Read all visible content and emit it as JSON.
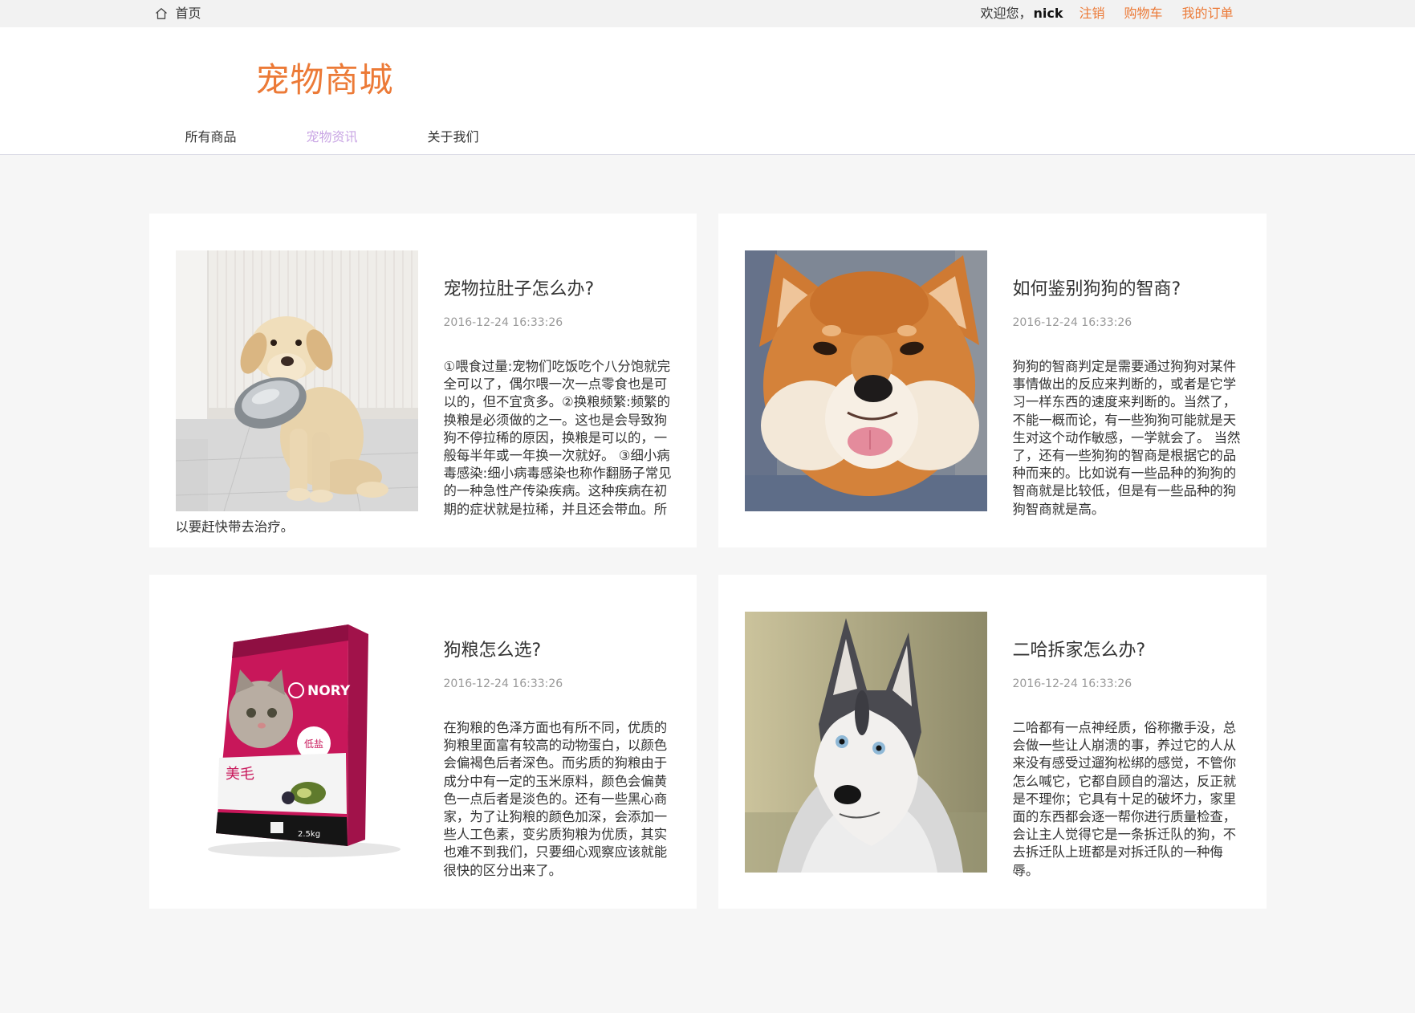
{
  "topbar": {
    "home_icon": "home-icon",
    "home_label": "首页",
    "welcome_text": "欢迎您，",
    "username": "nick",
    "links": [
      {
        "label": "注销"
      },
      {
        "label": "购物车"
      },
      {
        "label": "我的订单"
      }
    ]
  },
  "header": {
    "logo_text": "宠物商城",
    "nav": [
      {
        "label": "所有商品",
        "active": false
      },
      {
        "label": "宠物资讯",
        "active": true
      },
      {
        "label": "关于我们",
        "active": false
      }
    ]
  },
  "articles": [
    {
      "title": "宠物拉肚子怎么办?",
      "date": "2016-12-24 16:33:26",
      "content": "①喂食过量:宠物们吃饭吃个八分饱就完全可以了，偶尔喂一次一点零食也是可以的，但不宜贪多。②换粮频繁:频繁的换粮是必须做的之一。这也是会导致狗狗不停拉稀的原因，换粮是可以的，一般每半年或一年换一次就好。 ③细小病毒感染:细小病毒感染也称作翻肠子常见的一种急性产传染疾病。这种疾病在初期的症状就是拉稀，并且还会带血。所以要赶快带去治疗。"
    },
    {
      "title": "如何鉴别狗狗的智商?",
      "date": "2016-12-24 16:33:26",
      "content": "狗狗的智商判定是需要通过狗狗对某件事情做出的反应来判断的，或者是它学习一样东西的速度来判断的。当然了，不能一概而论，有一些狗狗可能就是天生对这个动作敏感，一学就会了。 当然了，还有一些狗狗的智商是根据它的品种而来的。比如说有一些品种的狗狗的智商就是比较低，但是有一些品种的狗狗智商就是高。"
    },
    {
      "title": "狗粮怎么选?",
      "date": "2016-12-24 16:33:26",
      "content": "在狗粮的色泽方面也有所不同，优质的狗粮里面富有较高的动物蛋白，以颜色会偏褐色后者深色。而劣质的狗粮由于成分中有一定的玉米原料，颜色会偏黄色一点后者是淡色的。还有一些黑心商家，为了让狗粮的颜色加深，会添加一些人工色素，变劣质狗粮为优质，其实也难不到我们，只要细心观察应该就能很快的区分出来了。"
    },
    {
      "title": "二哈拆家怎么办?",
      "date": "2016-12-24 16:33:26",
      "content": "二哈都有一点神经质，俗称撒手没，总会做一些让人崩溃的事，养过它的人从来没有感受过遛狗松绑的感觉，不管你怎么喊它，它都自顾自的溜达，反正就是不理你；它具有十足的破坏力，家里面的东西都会逐一帮你进行质量检查，会让主人觉得它是一条拆迁队的狗，不去拆迁队上班都是对拆迁队的一种侮辱。"
    }
  ],
  "dog_food_package": {
    "brand": "NORY",
    "badge": "低盐",
    "label": "美毛",
    "weight": "2.5kg"
  },
  "colors": {
    "accent": "#ec7a37",
    "nav_active": "#c9a6e4",
    "text": "#333333",
    "muted": "#999999",
    "page_background": "#f6f6f6",
    "topbar_background": "#f2f2f2",
    "card_background": "#ffffff"
  }
}
